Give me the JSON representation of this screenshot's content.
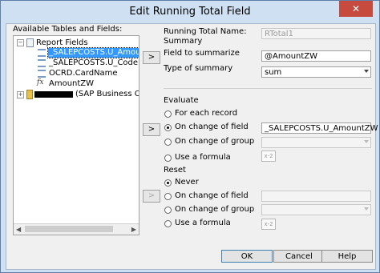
{
  "window": {
    "title": "Edit Running Total Field",
    "close": "✕"
  },
  "left": {
    "label": "Available Tables and Fields:",
    "tree": [
      {
        "text": "Report Fields",
        "toggle": "−"
      },
      {
        "text": "_SALEPCOSTS.U_AmountZW",
        "selected": true
      },
      {
        "text": "_SALEPCOSTS.U_Code"
      },
      {
        "text": "OCRD.CardName"
      },
      {
        "text": "AmountZW",
        "icon": "fx"
      },
      {
        "text": "(SAP Business One)",
        "toggle": "+"
      }
    ]
  },
  "right": {
    "running_total_name_label": "Running Total Name:",
    "running_total_name_value": "RTotal1",
    "summary_label": "Summary",
    "field_to_summarize_label": "Field to summarize",
    "field_to_summarize_value": "@AmountZW",
    "type_of_summary_label": "Type of summary",
    "type_of_summary_value": "sum",
    "evaluate_label": "Evaluate",
    "evaluate_options": [
      "For each record",
      "On change of field",
      "On change of group",
      "Use a formula"
    ],
    "evaluate_field_value": "_SALEPCOSTS.U_AmountZW",
    "reset_label": "Reset",
    "reset_options": [
      "Never",
      "On change of field",
      "On change of group",
      "Use a formula"
    ],
    "formula_icon": "x-2"
  },
  "arrow_button": ">",
  "buttons": {
    "ok": "OK",
    "cancel": "Cancel",
    "help": "Help"
  }
}
